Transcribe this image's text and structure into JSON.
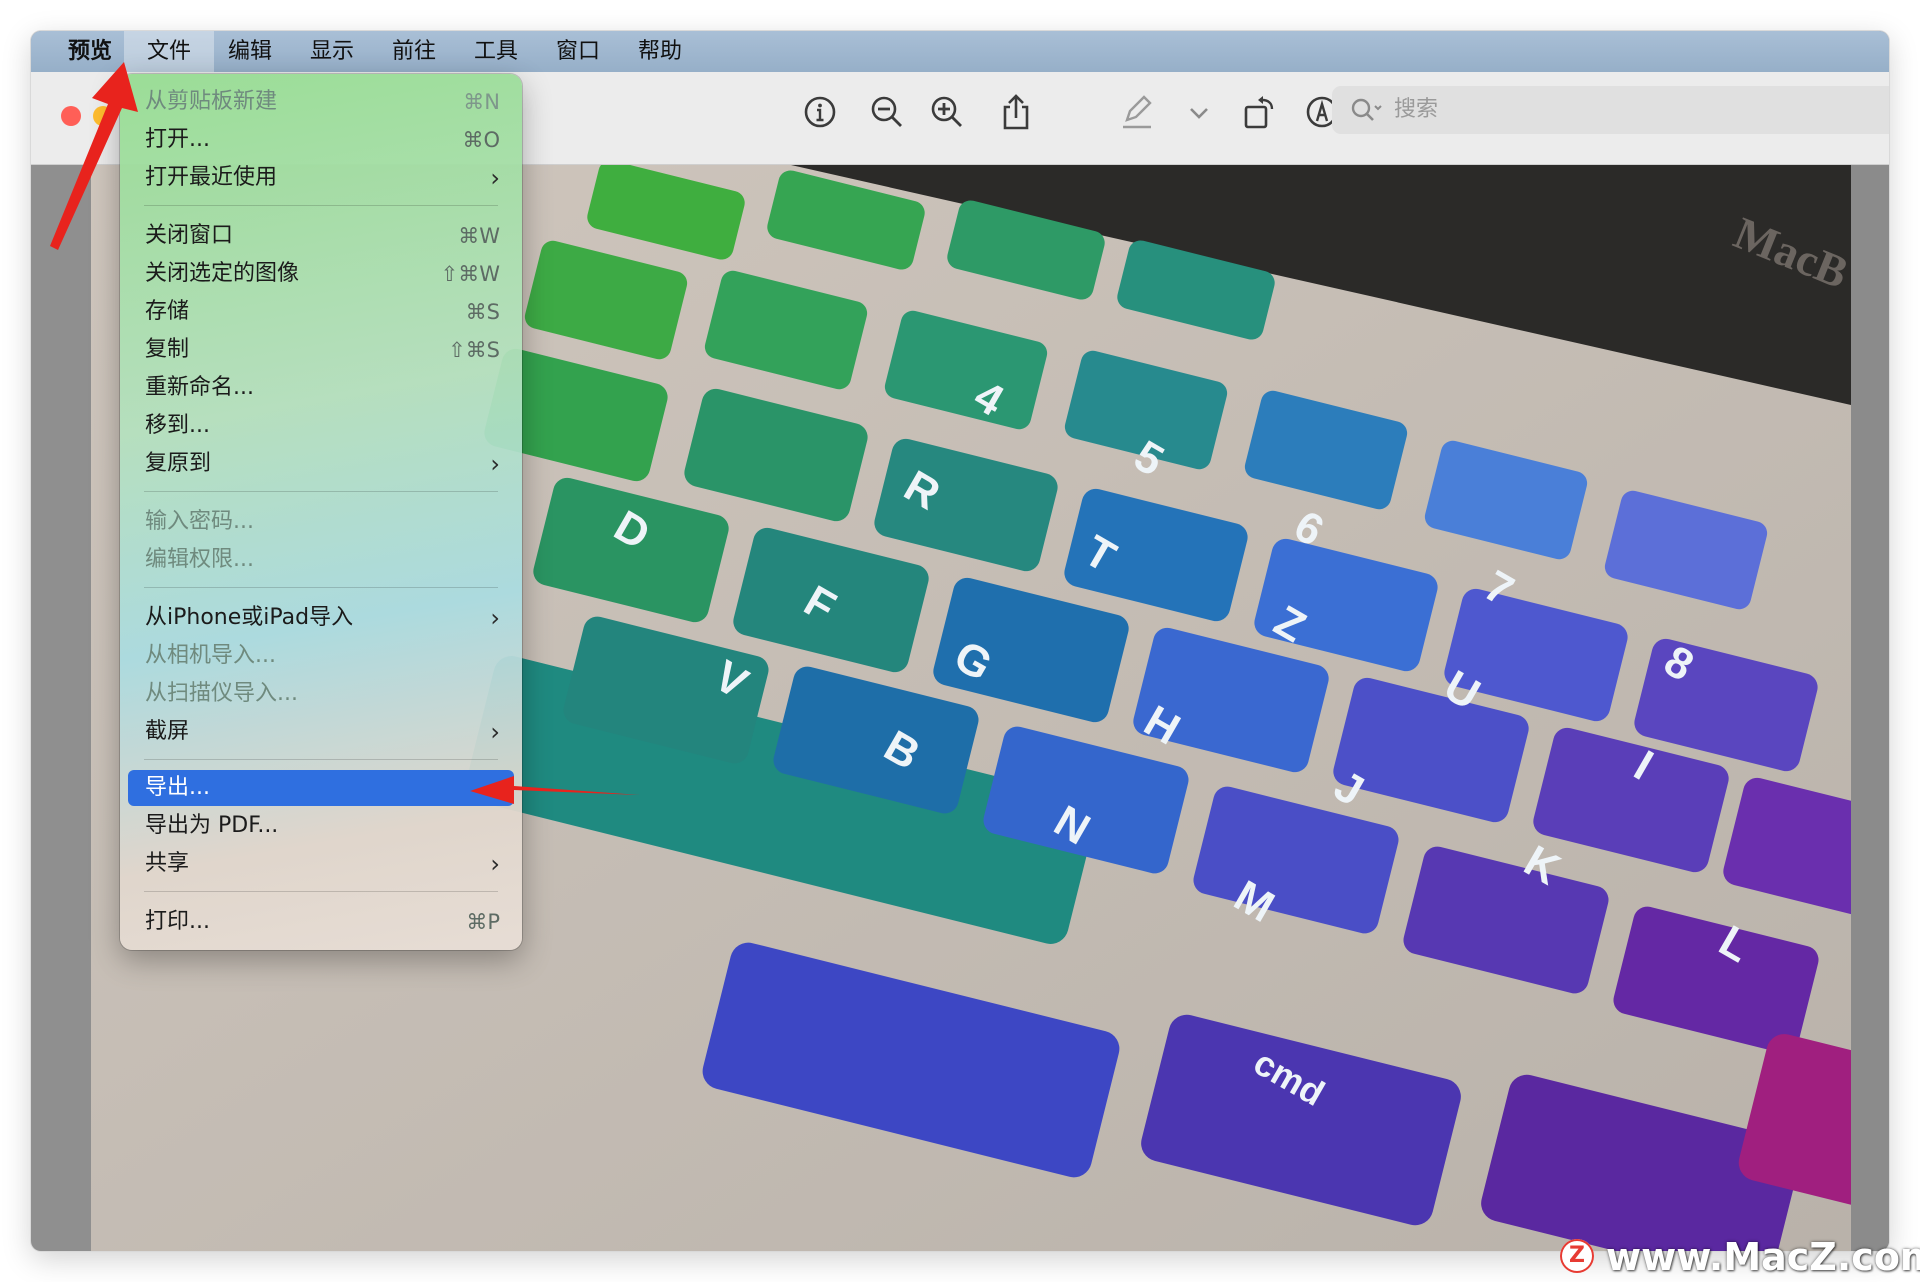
{
  "menubar": {
    "items": [
      "预览",
      "文件",
      "编辑",
      "显示",
      "前往",
      "工具",
      "窗口",
      "帮助"
    ]
  },
  "search": {
    "placeholder": "搜索"
  },
  "file_menu": {
    "items": [
      {
        "label": "从剪贴板新建",
        "shortcut": "⌘N",
        "disabled": true,
        "submenu": false
      },
      {
        "label": "打开...",
        "shortcut": "⌘O",
        "disabled": false,
        "submenu": false
      },
      {
        "label": "打开最近使用",
        "shortcut": "",
        "disabled": false,
        "submenu": true
      },
      {
        "label": "关闭窗口",
        "shortcut": "⌘W",
        "disabled": false,
        "submenu": false
      },
      {
        "label": "关闭选定的图像",
        "shortcut": "⇧⌘W",
        "disabled": false,
        "submenu": false
      },
      {
        "label": "存储",
        "shortcut": "⌘S",
        "disabled": false,
        "submenu": false
      },
      {
        "label": "复制",
        "shortcut": "⇧⌘S",
        "disabled": false,
        "submenu": false
      },
      {
        "label": "重新命名...",
        "shortcut": "",
        "disabled": false,
        "submenu": false
      },
      {
        "label": "移到...",
        "shortcut": "",
        "disabled": false,
        "submenu": false
      },
      {
        "label": "复原到",
        "shortcut": "",
        "disabled": false,
        "submenu": true
      },
      {
        "label": "输入密码...",
        "shortcut": "",
        "disabled": true,
        "submenu": false
      },
      {
        "label": "编辑权限...",
        "shortcut": "",
        "disabled": true,
        "submenu": false
      },
      {
        "label": "从iPhone或iPad导入",
        "shortcut": "",
        "disabled": false,
        "submenu": true
      },
      {
        "label": "从相机导入...",
        "shortcut": "",
        "disabled": true,
        "submenu": false
      },
      {
        "label": "从扫描仪导入...",
        "shortcut": "",
        "disabled": true,
        "submenu": false
      },
      {
        "label": "截屏",
        "shortcut": "",
        "disabled": false,
        "submenu": true
      },
      {
        "label": "导出...",
        "shortcut": "",
        "disabled": false,
        "submenu": false,
        "highlighted": true
      },
      {
        "label": "导出为 PDF...",
        "shortcut": "",
        "disabled": false,
        "submenu": false
      },
      {
        "label": "共享",
        "shortcut": "",
        "disabled": false,
        "submenu": true
      },
      {
        "label": "打印...",
        "shortcut": "⌘P",
        "disabled": false,
        "submenu": false
      }
    ]
  },
  "toolbar": {
    "icons": [
      "info-icon",
      "zoom-out-icon",
      "zoom-in-icon",
      "share-icon",
      "markup-pen-icon",
      "chevron-down-icon",
      "rotate-icon",
      "annotate-icon"
    ]
  },
  "photo": {
    "keys": [
      "D",
      "F",
      "G",
      "H",
      "J",
      "K",
      "L",
      "V",
      "B",
      "N",
      "M",
      "R",
      "T",
      "Z",
      "U",
      "I",
      "6",
      "7",
      "8",
      "5",
      "4",
      "cmd"
    ],
    "laptop_brand": "MacB"
  },
  "watermark": {
    "badge": "Z",
    "text": "www.MacZ.com"
  },
  "colors": {
    "menubar": "#9fb8cf",
    "highlight": "#2f6fe0",
    "arrow": "#e8231d",
    "close": "#ff5f57",
    "minimize": "#febc2e"
  }
}
